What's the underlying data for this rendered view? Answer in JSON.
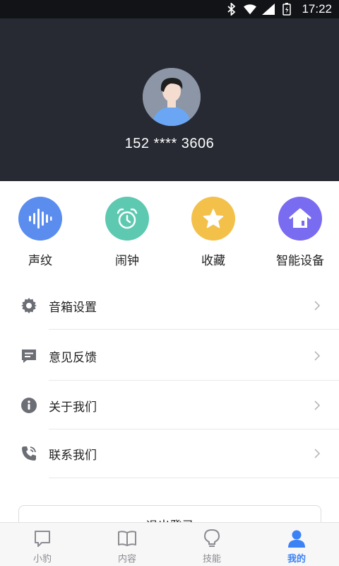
{
  "status_bar": {
    "time": "17:22"
  },
  "profile": {
    "phone": "152 **** 3606"
  },
  "quick_actions": [
    {
      "label": "声纹",
      "icon": "voiceprint-icon",
      "color": "#5b8def"
    },
    {
      "label": "闹钟",
      "icon": "alarm-clock-icon",
      "color": "#5cc9b0"
    },
    {
      "label": "收藏",
      "icon": "star-icon",
      "color": "#f3c14a"
    },
    {
      "label": "智能设备",
      "icon": "smart-home-icon",
      "color": "#7a6cf0"
    }
  ],
  "menu": [
    {
      "label": "音箱设置",
      "icon": "gear-icon"
    },
    {
      "label": "意见反馈",
      "icon": "feedback-icon"
    },
    {
      "label": "关于我们",
      "icon": "info-icon"
    },
    {
      "label": "联系我们",
      "icon": "phone-icon"
    }
  ],
  "logout_label": "退出登录",
  "tabs": [
    {
      "label": "小豹",
      "icon": "chat-bubble-icon"
    },
    {
      "label": "内容",
      "icon": "book-icon"
    },
    {
      "label": "技能",
      "icon": "lightbulb-icon"
    },
    {
      "label": "我的",
      "icon": "user-icon",
      "active": true
    }
  ],
  "colors": {
    "accent": "#3b82f6",
    "header_bg": "#272a33"
  }
}
